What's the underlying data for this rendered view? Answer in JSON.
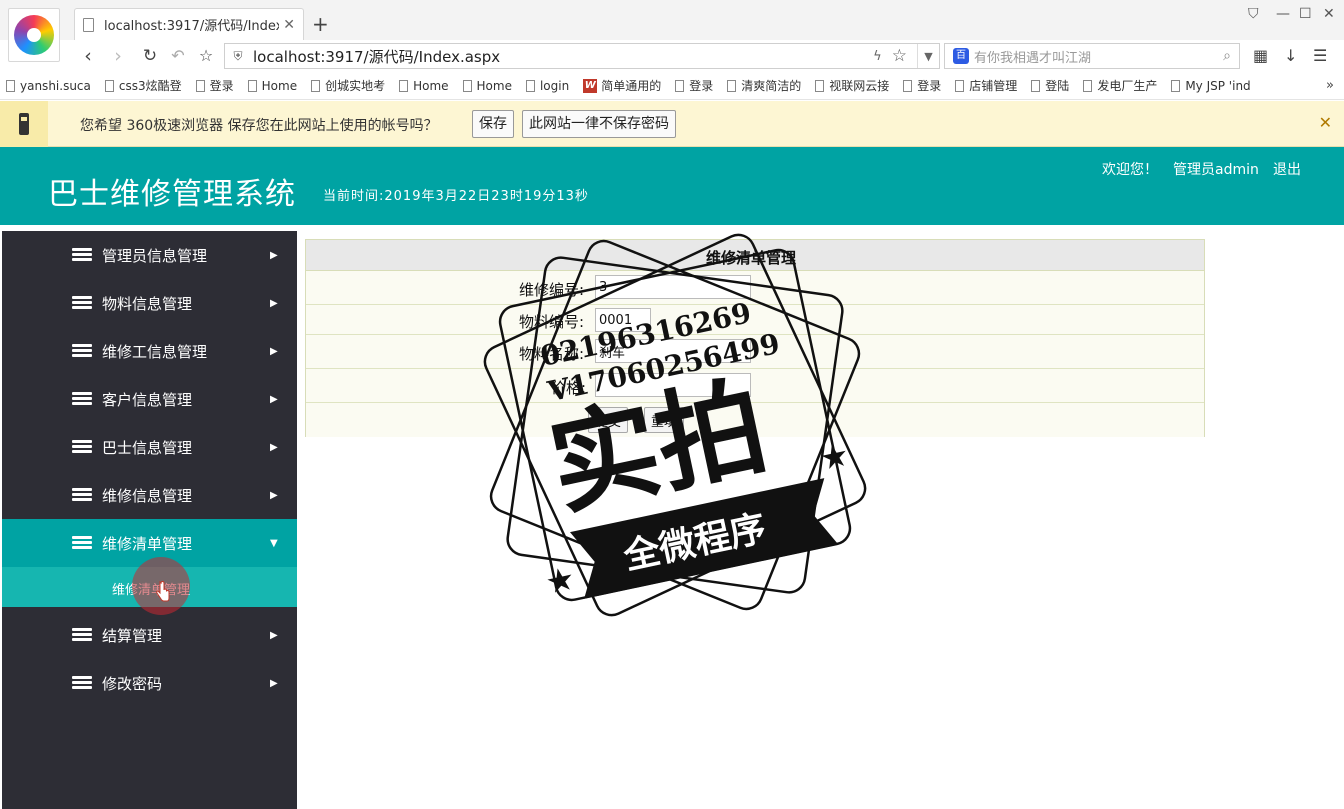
{
  "browser": {
    "tab_title": "localhost:3917/源代码/Index.a",
    "url": "localhost:3917/源代码/Index.aspx",
    "search_placeholder": "有你我相遇才叫江湖"
  },
  "bookmarks": [
    {
      "label": "yanshi.suca",
      "icon": "doc"
    },
    {
      "label": "css3炫酷登",
      "icon": "doc"
    },
    {
      "label": "登录",
      "icon": "doc"
    },
    {
      "label": "Home",
      "icon": "doc"
    },
    {
      "label": "创城实地考",
      "icon": "doc"
    },
    {
      "label": "Home",
      "icon": "doc"
    },
    {
      "label": "Home",
      "icon": "doc"
    },
    {
      "label": "login",
      "icon": "doc"
    },
    {
      "label": "简单通用的",
      "icon": "red"
    },
    {
      "label": "登录",
      "icon": "doc"
    },
    {
      "label": "清爽简洁的",
      "icon": "doc"
    },
    {
      "label": "视联网云接",
      "icon": "doc"
    },
    {
      "label": "登录",
      "icon": "doc"
    },
    {
      "label": "店铺管理",
      "icon": "doc"
    },
    {
      "label": "登陆",
      "icon": "doc"
    },
    {
      "label": "发电厂生产",
      "icon": "doc"
    },
    {
      "label": "My JSP 'ind",
      "icon": "doc"
    }
  ],
  "password_bar": {
    "message": "您希望 360极速浏览器 保存您在此网站上使用的帐号吗？",
    "save_label": "保存",
    "never_label": "此网站一律不保存密码"
  },
  "header": {
    "title": "巴士维修管理系统",
    "time": "当前时间:2019年3月22日23时19分13秒",
    "welcome": "欢迎您！",
    "user": "管理员admin",
    "logout": "退出"
  },
  "sidebar": {
    "items": [
      {
        "label": "管理员信息管理",
        "arrow": "▶"
      },
      {
        "label": "物料信息管理",
        "arrow": "▶"
      },
      {
        "label": "维修工信息管理",
        "arrow": "▶"
      },
      {
        "label": "客户信息管理",
        "arrow": "▶"
      },
      {
        "label": "巴士信息管理",
        "arrow": "▶"
      },
      {
        "label": "维修信息管理",
        "arrow": "▶"
      },
      {
        "label": "维修清单管理",
        "arrow": "▼"
      },
      {
        "label": "结算管理",
        "arrow": "▶"
      },
      {
        "label": "修改密码",
        "arrow": "▶"
      }
    ],
    "submenu_label": "维修清单管理"
  },
  "form": {
    "title": "维修清单管理",
    "fields": [
      {
        "label": "维修编号:",
        "value": "3"
      },
      {
        "label": "物料编号:",
        "value": "0001"
      },
      {
        "label": "物料名称:",
        "value": "刹车"
      },
      {
        "label": "价格:",
        "value": ""
      }
    ],
    "submit_label": "提交",
    "reset_label": "重填"
  },
  "watermark": {
    "line1": "02196316269",
    "line2": "V17060256499",
    "main": "实拍",
    "banner": "全微程序"
  },
  "colors": {
    "accent": "#00a3a3",
    "sidebar_bg": "#2d2d35",
    "submenu_bg": "#16b6b0",
    "password_bar_bg": "#fdf6d3"
  }
}
